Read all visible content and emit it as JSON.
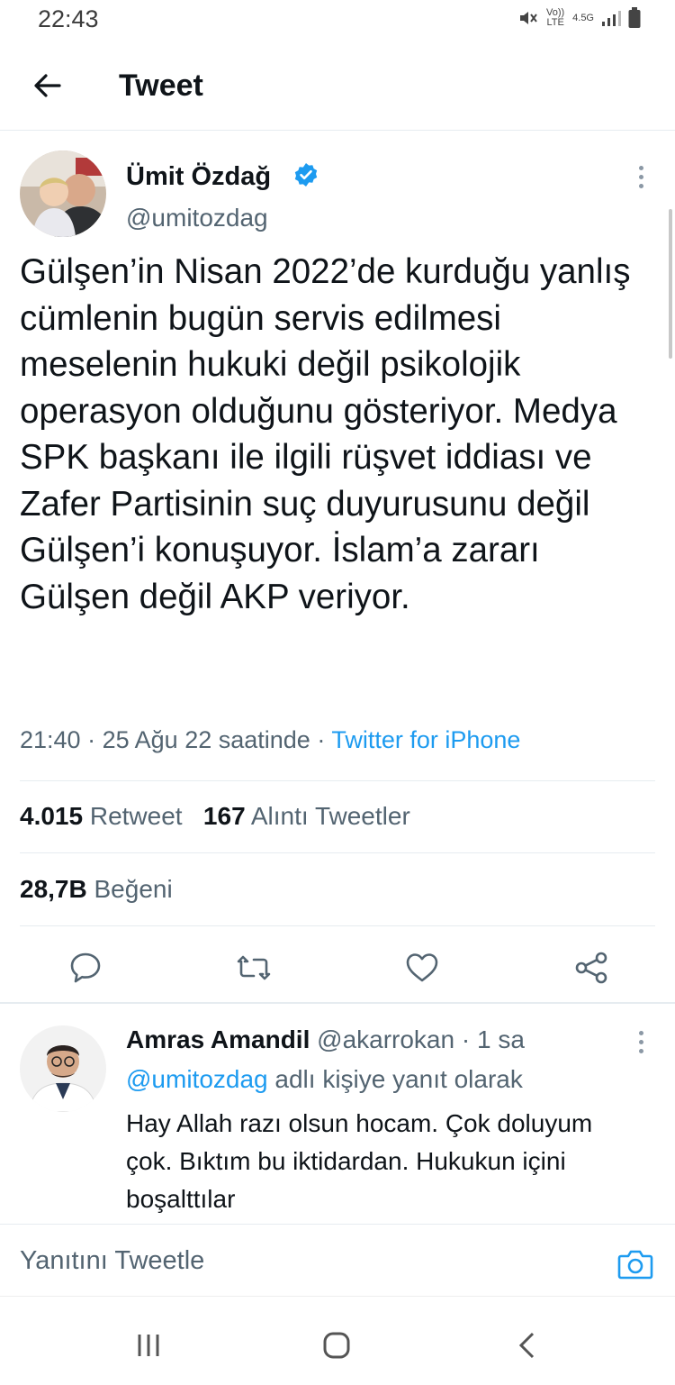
{
  "status_bar": {
    "time": "22:43",
    "volte": "Vo)) LTE",
    "network": "4.5G"
  },
  "header": {
    "title": "Tweet"
  },
  "tweet": {
    "author_name": "Ümit Özdağ",
    "author_handle": "@umitozdag",
    "verified": true,
    "text": "Gülşen’in Nisan 2022’de kurduğu yanlış cümlenin bugün servis edilmesi meselenin hukuki değil psikolojik operasyon olduğunu gösteriyor. Medya SPK başkanı ile ilgili rüşvet iddiası ve Zafer Partisinin suç duyurusunu değil Gülşen’i konuşuyor. İslam’a zararı Gülşen değil AKP veriyor.",
    "time": "21:40",
    "date": "25 Ağu 22 saatinde",
    "separator": "·",
    "source": "Twitter for iPhone",
    "retweets_count": "4.015",
    "retweets_label": "Retweet",
    "quotes_count": "167",
    "quotes_label": "Alıntı Tweetler",
    "likes_count": "28,7B",
    "likes_label": "Beğeni"
  },
  "reply": {
    "name": "Amras Amandil",
    "handle": "@akarrokan",
    "time": "· 1 sa",
    "replying_mention": "@umitozdag",
    "replying_suffix": "adlı kişiye yanıt olarak",
    "text": "Hay Allah razı olsun hocam. Çok doluyum çok. Bıktım bu iktidardan. Hukukun içini boşalttılar"
  },
  "compose": {
    "placeholder": "Yanıtını Tweetle"
  },
  "colors": {
    "accent": "#1d9bf0",
    "text": "#0f1419",
    "secondary": "#536471",
    "divider": "#e6ecf0"
  }
}
